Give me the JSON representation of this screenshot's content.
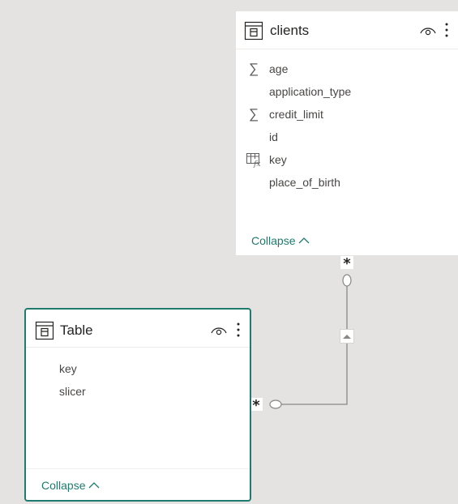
{
  "clients": {
    "title": "clients",
    "fields": [
      {
        "label": "age",
        "icon": "sigma-icon"
      },
      {
        "label": "application_type",
        "icon": ""
      },
      {
        "label": "credit_limit",
        "icon": "sigma-icon"
      },
      {
        "label": "id",
        "icon": ""
      },
      {
        "label": "key",
        "icon": "calculated-column-icon"
      },
      {
        "label": "place_of_birth",
        "icon": ""
      }
    ],
    "collapse_label": "Collapse"
  },
  "table": {
    "title": "Table",
    "fields": [
      {
        "label": "key",
        "icon": ""
      },
      {
        "label": "slicer",
        "icon": ""
      }
    ],
    "collapse_label": "Collapse"
  },
  "relationship": {
    "from_cardinality": "*",
    "to_cardinality": "*",
    "filter_direction": "single"
  },
  "colors": {
    "accent": "#1e7b6e",
    "canvas": "#e5e3e1"
  }
}
